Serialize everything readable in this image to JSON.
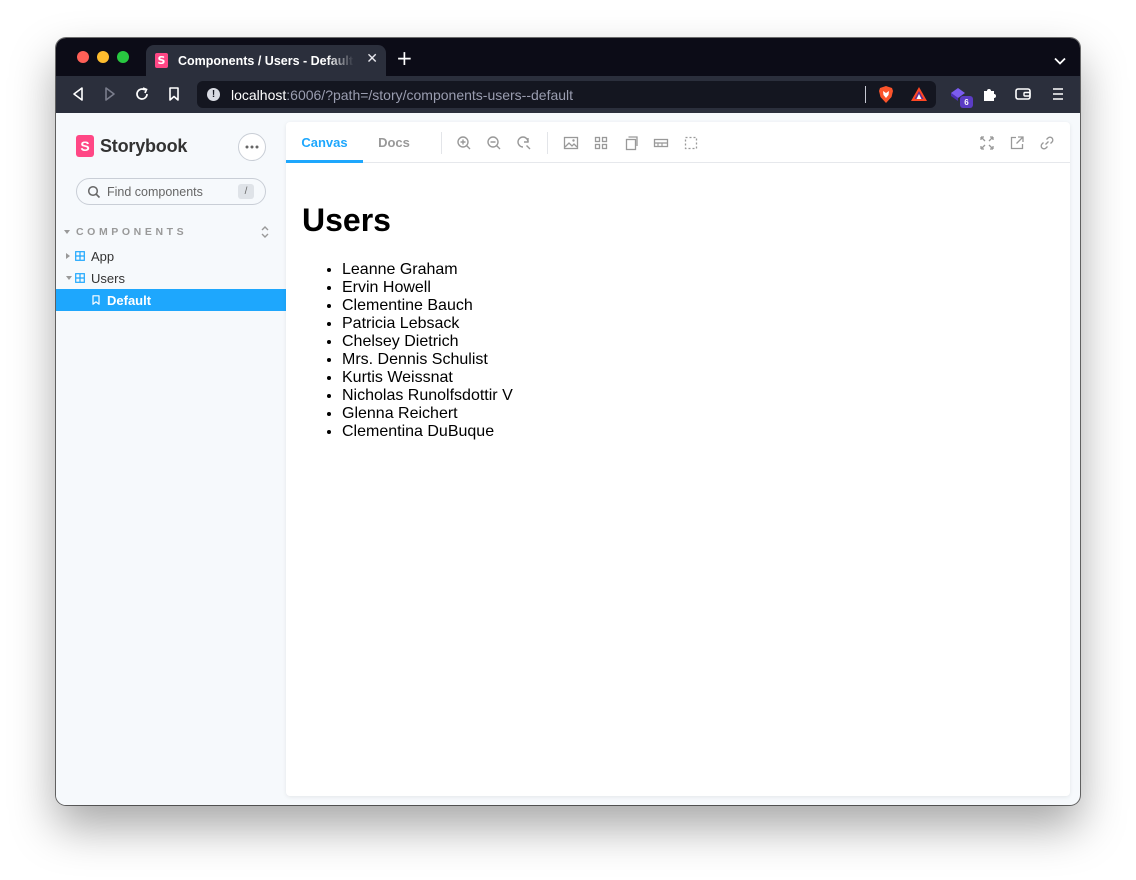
{
  "browser": {
    "tab_title": "Components / Users - Default",
    "url_host": "localhost",
    "url_rest": ":6006/?path=/story/components-users--default",
    "extension_badge": "6"
  },
  "sidebar": {
    "brand": "Storybook",
    "search_placeholder": "Find components",
    "search_shortcut": "/",
    "section_label": "COMPONENTS",
    "items": [
      {
        "label": "App",
        "icon": "component-icon",
        "expanded": false
      },
      {
        "label": "Users",
        "icon": "component-icon",
        "expanded": true
      },
      {
        "label": "Default",
        "icon": "bookmark-icon",
        "selected": true
      }
    ]
  },
  "panel": {
    "tabs": [
      {
        "label": "Canvas",
        "active": true
      },
      {
        "label": "Docs",
        "active": false
      }
    ]
  },
  "canvas": {
    "heading": "Users",
    "users": [
      "Leanne Graham",
      "Ervin Howell",
      "Clementine Bauch",
      "Patricia Lebsack",
      "Chelsey Dietrich",
      "Mrs. Dennis Schulist",
      "Kurtis Weissnat",
      "Nicholas Runolfsdottir V",
      "Glenna Reichert",
      "Clementina DuBuque"
    ]
  },
  "colors": {
    "accent": "#1ea7fd",
    "brand": "#ff4785",
    "sidebar_bg": "#f6f9fc",
    "chrome_dark": "#2b2f3c"
  }
}
